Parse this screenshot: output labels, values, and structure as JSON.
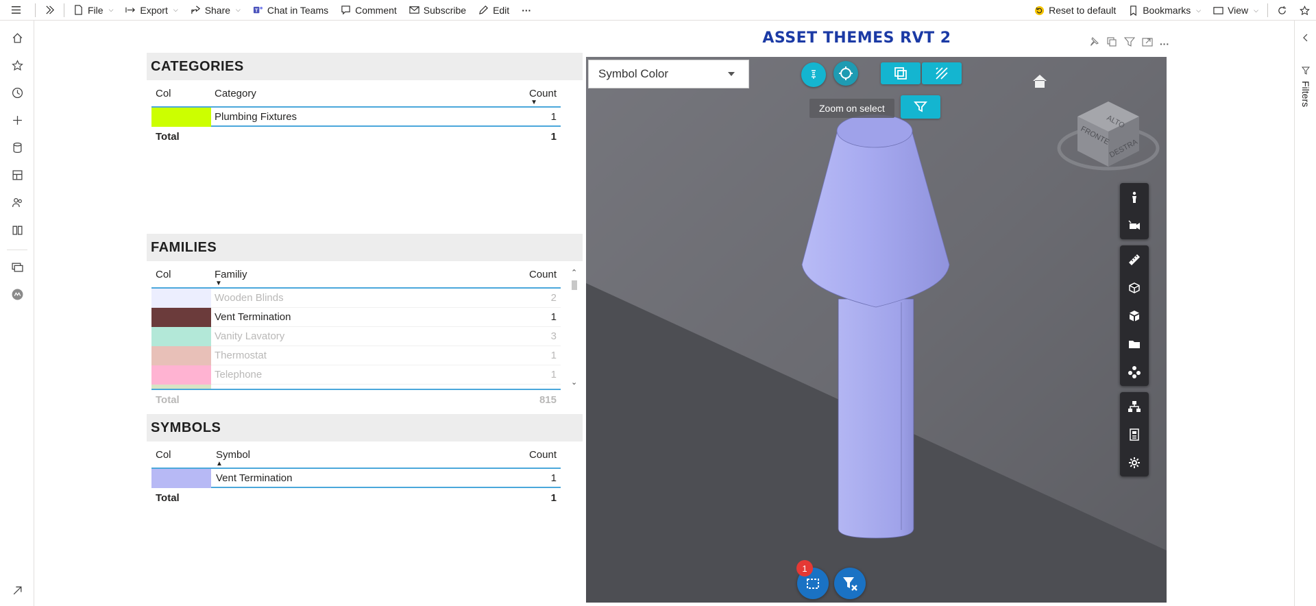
{
  "toolbar": {
    "file": "File",
    "export": "Export",
    "share": "Share",
    "chat": "Chat in Teams",
    "comment": "Comment",
    "subscribe": "Subscribe",
    "edit": "Edit",
    "more": "···",
    "reset": "Reset to default",
    "bookmarks": "Bookmarks",
    "view": "View"
  },
  "report": {
    "title": "ASSET THEMES RVT 2",
    "more": "···"
  },
  "rightrail": {
    "filters_label": "Filters"
  },
  "categories": {
    "title": "CATEGORIES",
    "col_header": "Col",
    "name_header": "Category",
    "count_header": "Count",
    "rows": [
      {
        "name": "Plumbing Fixtures",
        "count": "1",
        "color": "#ccff00"
      }
    ],
    "total_label": "Total",
    "total_value": "1"
  },
  "families": {
    "title": "FAMILIES",
    "col_header": "Col",
    "name_header": "Familiy",
    "count_header": "Count",
    "rows": [
      {
        "name": "Wooden Blinds",
        "count": "2",
        "color": "#eceefe",
        "dimmed": true
      },
      {
        "name": "Vent Termination",
        "count": "1",
        "color": "#6b3b3b",
        "dimmed": false
      },
      {
        "name": "Vanity Lavatory",
        "count": "3",
        "color": "#b3e8d8",
        "dimmed": true
      },
      {
        "name": "Thermostat",
        "count": "1",
        "color": "#e8c0b8",
        "dimmed": true
      },
      {
        "name": "Telephone",
        "count": "1",
        "color": "#ffb3d2",
        "dimmed": true
      }
    ],
    "total_label": "Total",
    "total_value": "815"
  },
  "symbols": {
    "title": "SYMBOLS",
    "col_header": "Col",
    "name_header": "Symbol",
    "count_header": "Count",
    "rows": [
      {
        "name": "Vent Termination",
        "count": "1",
        "color": "#b7b9f5"
      }
    ],
    "total_label": "Total",
    "total_value": "1"
  },
  "viewer": {
    "dropdown_value": "Symbol Color",
    "tooltip": "Zoom on select",
    "selection_badge": "1",
    "viewcube_top": "ALTO",
    "viewcube_front": "FRONTE",
    "viewcube_right": "DESTRA",
    "object_color": "#a9abee"
  }
}
